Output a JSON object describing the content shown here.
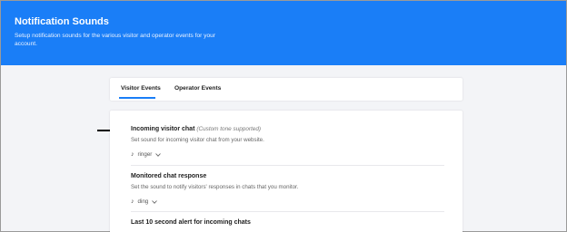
{
  "header": {
    "title": "Notification Sounds",
    "description": "Setup notification sounds for the various visitor and operator events for your account."
  },
  "tabs": [
    {
      "label": "Visitor Events",
      "active": true
    },
    {
      "label": "Operator Events",
      "active": false
    }
  ],
  "events": [
    {
      "title": "Incoming visitor chat",
      "hint": "(Custom tone supported)",
      "description": "Set sound for incoming visitor chat from your website.",
      "sound": "ringer",
      "icon": "music-note-icon"
    },
    {
      "title": "Monitored chat response",
      "description": "Set the sound to notify visitors' responses in chats that you monitor.",
      "sound": "ding",
      "icon": "music-note-icon"
    },
    {
      "title": "Last 10 second alert for incoming chats"
    }
  ],
  "colors": {
    "accent": "#1a7ef7",
    "background": "#f3f4f7"
  }
}
